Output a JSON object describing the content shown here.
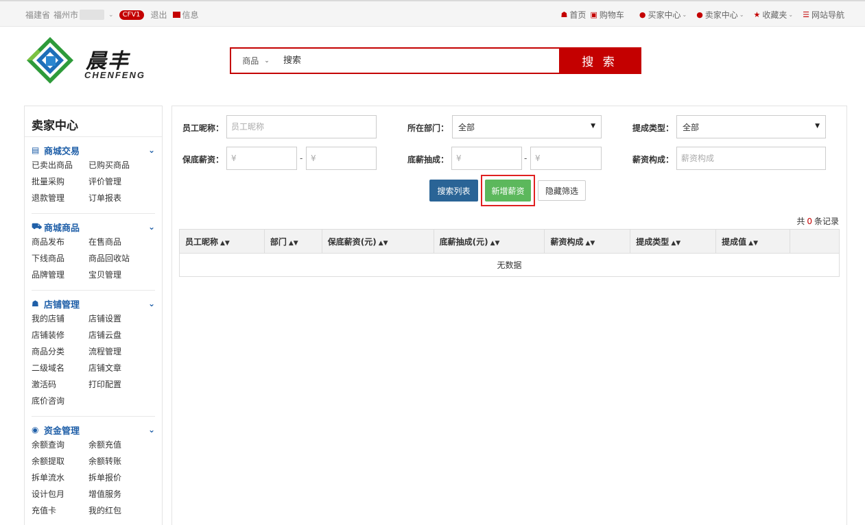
{
  "topbar": {
    "province": "福建省",
    "city": "福州市",
    "user_badge": "CFV1",
    "logout": "退出",
    "messages": "信息",
    "links": {
      "home": "首页",
      "cart": "购物车",
      "buyer": "买家中心",
      "seller": "卖家中心",
      "favorites": "收藏夹",
      "sitenav": "网站导航"
    }
  },
  "logo": {
    "cn": "晨丰",
    "en": "CHENFENG"
  },
  "search": {
    "category": "商品",
    "query": "搜索",
    "button": "搜 索"
  },
  "sidebar": {
    "title": "卖家中心",
    "groups": [
      {
        "title": "商城交易",
        "icon": "list-icon",
        "items": [
          "已卖出商品",
          "已购买商品",
          "批量采购",
          "评价管理",
          "退款管理",
          "订单报表"
        ]
      },
      {
        "title": "商城商品",
        "icon": "truck-icon",
        "items": [
          "商品发布",
          "在售商品",
          "下线商品",
          "商品回收站",
          "品牌管理",
          "宝贝管理"
        ]
      },
      {
        "title": "店铺管理",
        "icon": "home-icon",
        "items": [
          "我的店铺",
          "店铺设置",
          "店铺装修",
          "店铺云盘",
          "商品分类",
          "流程管理",
          "二级域名",
          "店铺文章",
          "激活码",
          "打印配置",
          "底价咨询"
        ]
      },
      {
        "title": "资金管理",
        "icon": "money-icon",
        "items": [
          "余额查询",
          "余额充值",
          "余额提取",
          "余额转账",
          "拆单流水",
          "拆单报价",
          "设计包月",
          "增值服务",
          "充值卡",
          "我的红包"
        ]
      }
    ]
  },
  "filters": {
    "nickname_label": "员工昵称：",
    "nickname_placeholder": "员工昵称",
    "dept_label": "所在部门：",
    "dept_value": "全部",
    "type_label": "提成类型：",
    "type_value": "全部",
    "base_label": "保底薪资：",
    "yen": "¥",
    "dash": "-",
    "commission_label": "底薪抽成：",
    "composition_label": "薪资构成：",
    "composition_placeholder": "薪资构成"
  },
  "buttons": {
    "search": "搜索列表",
    "add": "新增薪资",
    "hide": "隐藏筛选"
  },
  "records": {
    "prefix": "共",
    "count": "0",
    "suffix": "条记录"
  },
  "table": {
    "columns": [
      "员工昵称",
      "部门",
      "保底薪资(元)",
      "底薪抽成(元)",
      "薪资构成",
      "提成类型",
      "提成值"
    ],
    "empty": "无数据"
  },
  "colors": {
    "brand_red": "#c40000",
    "link_blue": "#1f5fa8",
    "primary_btn": "#2a6496",
    "success_btn": "#5cb85c"
  }
}
